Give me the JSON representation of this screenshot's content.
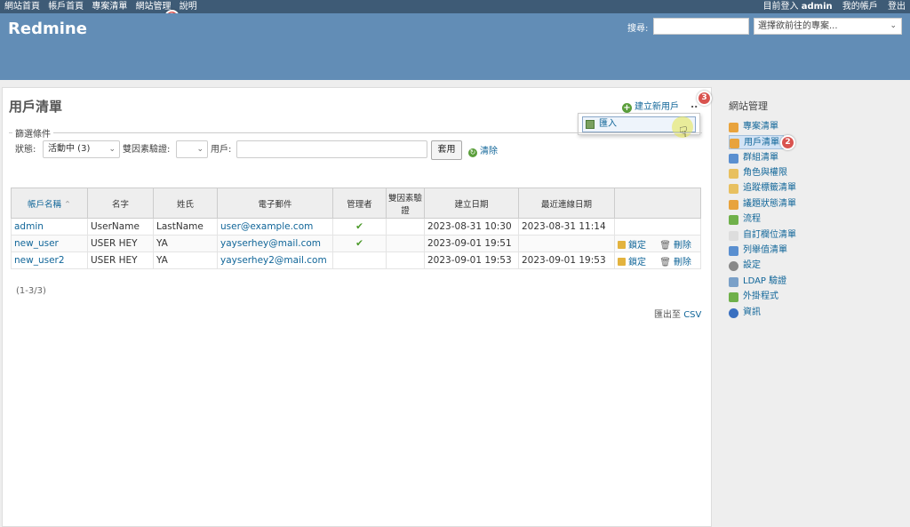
{
  "top_menu": {
    "left": [
      "網站首頁",
      "帳戶首頁",
      "專案清單",
      "網站管理",
      "說明"
    ],
    "logged_in_prefix": "目前登入",
    "logged_in_user": "admin",
    "my_account": "我的帳戶",
    "logout": "登出"
  },
  "header": {
    "app_name": "Redmine",
    "search_label": "搜尋:",
    "search_value": "",
    "jump_placeholder": "選擇欲前往的專案..."
  },
  "content": {
    "title": "用戶清單",
    "new_user": "建立新用戶",
    "more": "..",
    "dropdown_import": "匯入",
    "filters": {
      "legend": "篩選條件",
      "status_label": "狀態:",
      "status_value": "活動中 (3)",
      "twofa_label": "雙因素驗證:",
      "twofa_value": "",
      "user_label": "用戶:",
      "user_value": "",
      "apply": "套用",
      "clear": "清除"
    },
    "table": {
      "headers": [
        "帳戶名稱",
        "名字",
        "姓氏",
        "電子郵件",
        "管理者",
        "雙因素驗證",
        "建立日期",
        "最近連線日期",
        ""
      ],
      "rows": [
        {
          "login": "admin",
          "firstname": "UserName",
          "lastname": "LastName",
          "email": "user@example.com",
          "admin": "✔",
          "twofa": "",
          "created": "2023-08-31 10:30",
          "last_login": "2023-08-31 11:14",
          "lock": "",
          "delete": ""
        },
        {
          "login": "new_user",
          "firstname": "USER HEY",
          "lastname": "YA",
          "email": "yayserhey@mail.com",
          "admin": "✔",
          "twofa": "",
          "created": "2023-09-01 19:51",
          "last_login": "",
          "lock": "鎖定",
          "delete": "刪除"
        },
        {
          "login": "new_user2",
          "firstname": "USER HEY",
          "lastname": "YA",
          "email": "yayserhey2@mail.com",
          "admin": "",
          "twofa": "",
          "created": "2023-09-01 19:53",
          "last_login": "2023-09-01 19:53",
          "lock": "鎖定",
          "delete": "刪除"
        }
      ]
    },
    "pagination": "(1-3/3)",
    "export_prefix": "匯出至",
    "export_csv": "CSV"
  },
  "sidebar": {
    "title": "網站管理",
    "items": [
      {
        "label": "專案清單",
        "icon": "projects-icon",
        "color": "#e8a33d"
      },
      {
        "label": "用戶清單",
        "icon": "users-icon",
        "color": "#e8a33d"
      },
      {
        "label": "群組清單",
        "icon": "groups-icon",
        "color": "#5a8fd0"
      },
      {
        "label": "角色與權限",
        "icon": "roles-icon",
        "color": "#e8c060"
      },
      {
        "label": "追蹤標籤清單",
        "icon": "trackers-icon",
        "color": "#e8c060"
      },
      {
        "label": "議題狀態清單",
        "icon": "issue-status-icon",
        "color": "#e8a33d"
      },
      {
        "label": "流程",
        "icon": "workflow-icon",
        "color": "#6fb04a"
      },
      {
        "label": "自訂欄位清單",
        "icon": "custom-fields-icon",
        "color": "#dddddd"
      },
      {
        "label": "列舉值清單",
        "icon": "enumerations-icon",
        "color": "#5a8fd0"
      },
      {
        "label": "設定",
        "icon": "settings-icon",
        "color": "#888888"
      },
      {
        "label": "LDAP 驗證",
        "icon": "ldap-icon",
        "color": "#7aa0c8"
      },
      {
        "label": "外掛程式",
        "icon": "plugins-icon",
        "color": "#6fb04a"
      },
      {
        "label": "資訊",
        "icon": "info-icon",
        "color": "#3a70c0"
      }
    ]
  },
  "badges": [
    "1",
    "2",
    "3"
  ],
  "colors": {
    "top_bar": "#3e5b76",
    "header": "#628db6",
    "link": "#169",
    "badge": "#d9534f"
  }
}
